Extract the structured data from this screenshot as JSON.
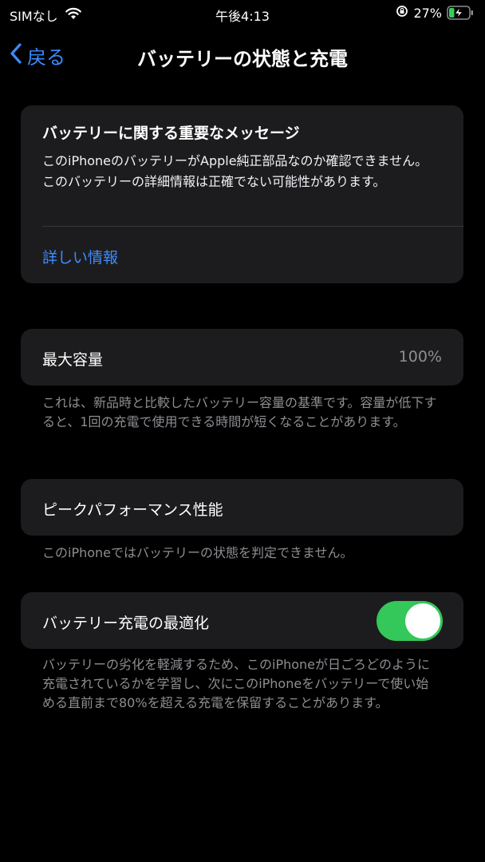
{
  "status_bar": {
    "carrier": "SIMなし",
    "time": "午後4:13",
    "battery_percent": "27%",
    "battery_level": 0.27
  },
  "nav": {
    "back_label": "戻る",
    "title": "バッテリーの状態と充電"
  },
  "message": {
    "title": "バッテリーに関する重要なメッセージ",
    "body": "このiPhoneのバッテリーがApple純正部品なのか確認できません。このバッテリーの詳細情報は正確でない可能性があります。",
    "link": "詳しい情報"
  },
  "capacity": {
    "label": "最大容量",
    "value": "100%",
    "note": "これは、新品時と比較したバッテリー容量の基準です。容量が低下すると、1回の充電で使用できる時間が短くなることがあります。"
  },
  "peak": {
    "label": "ピークパフォーマンス性能",
    "note": "このiPhoneではバッテリーの状態を判定できません。"
  },
  "optimize": {
    "label": "バッテリー充電の最適化",
    "enabled": true,
    "note": "バッテリーの劣化を軽減するため、このiPhoneが日ごろどのように充電されているかを学習し、次にこのiPhoneをバッテリーで使い始める直前まで80%を超える充電を保留することがあります。"
  },
  "colors": {
    "accent": "#3d8bff",
    "toggle_on": "#34c759",
    "battery_charging": "#30d158"
  }
}
